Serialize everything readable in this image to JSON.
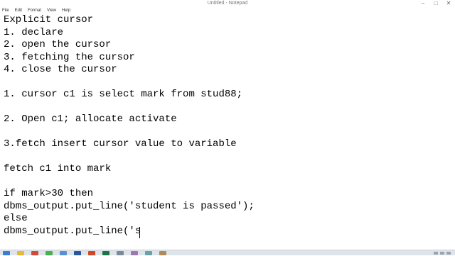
{
  "window": {
    "title": "Untitled - Notepad",
    "controls": {
      "minimize": "–",
      "maximize": "□",
      "close": "✕"
    }
  },
  "menu": [
    "File",
    "Edit",
    "Format",
    "View",
    "Help"
  ],
  "editor": {
    "lines": [
      "Explicit cursor",
      "1. declare",
      "2. open the cursor",
      "3. fetching the cursor",
      "4. close the cursor",
      "",
      "1. cursor c1 is select mark from stud88;",
      "",
      "2. Open c1; allocate activate",
      "",
      "3.fetch insert cursor value to variable",
      "",
      "fetch c1 into mark",
      "",
      "if mark>30 then",
      "dbms_output.put_line('student is passed');",
      "else",
      "dbms_output.put_line('s"
    ]
  },
  "taskbar": {
    "icons": [
      {
        "name": "start-icon",
        "color": "#3a7bd5"
      },
      {
        "name": "explorer-icon",
        "color": "#e8b83a"
      },
      {
        "name": "media-icon",
        "color": "#d04a3a"
      },
      {
        "name": "chrome-icon",
        "color": "#4caf50"
      },
      {
        "name": "notepad-icon",
        "color": "#5a8ecf"
      },
      {
        "name": "word-icon",
        "color": "#2b579a"
      },
      {
        "name": "powerpoint-icon",
        "color": "#d24726"
      },
      {
        "name": "excel-icon",
        "color": "#217346"
      },
      {
        "name": "app-icon",
        "color": "#7a8a99"
      },
      {
        "name": "app-icon",
        "color": "#9a7ab0"
      },
      {
        "name": "app-icon",
        "color": "#6aa0a8"
      },
      {
        "name": "app-icon",
        "color": "#b08a5a"
      }
    ]
  }
}
